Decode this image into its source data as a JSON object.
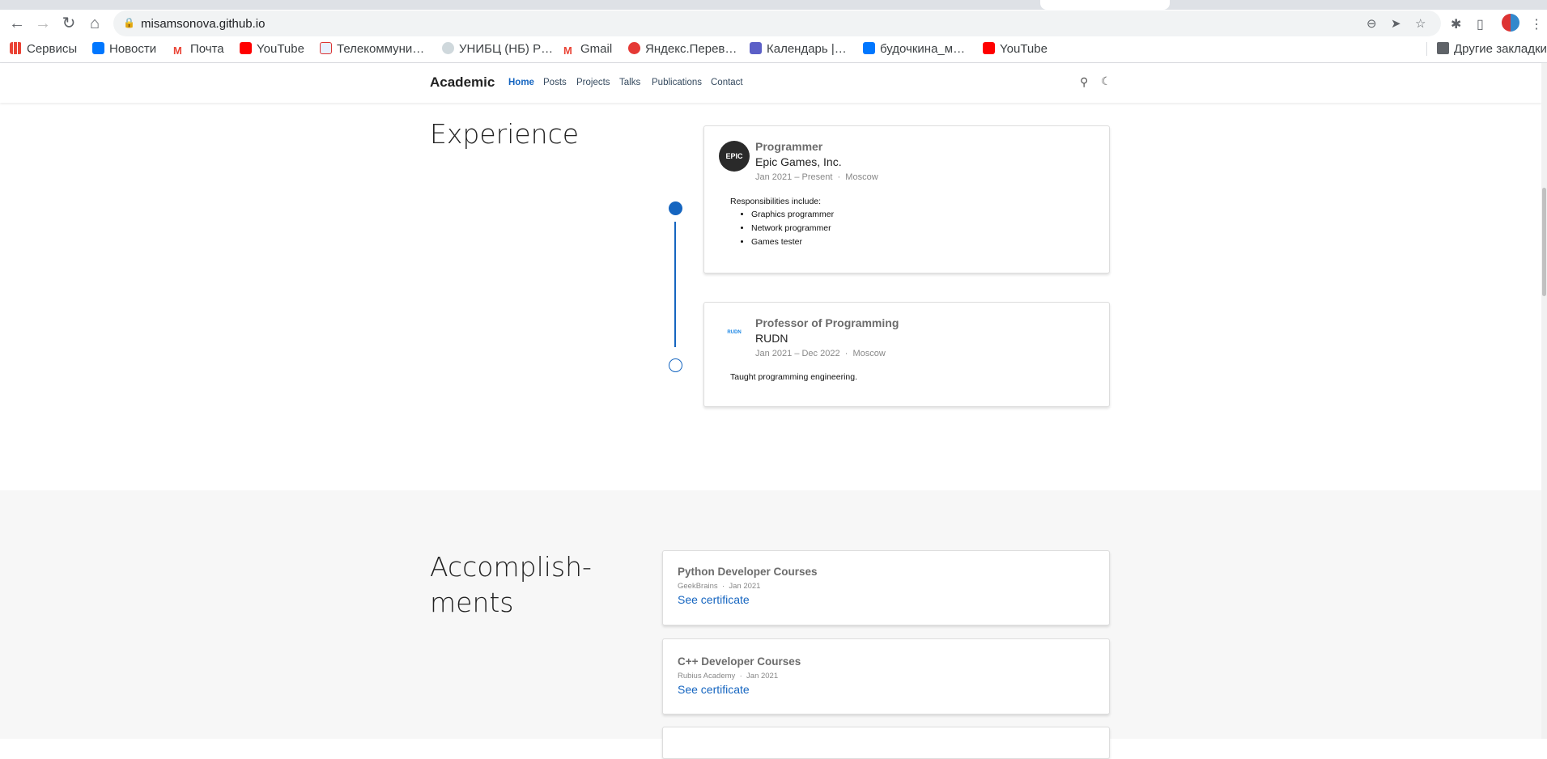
{
  "browser": {
    "url": "misamsonova.github.io",
    "bookmarks": [
      "Сервисы",
      "Новости",
      "Почта",
      "YouTube",
      "Телекоммуни…",
      "УНИБЦ (НБ) Р…",
      "Gmail",
      "Яндекс.Перев…",
      "Календарь |…",
      "будочкина_м…",
      "YouTube"
    ],
    "other_bookmarks": "Другие закладки"
  },
  "nav": {
    "brand": "Academic",
    "links": [
      "Home",
      "Posts",
      "Projects",
      "Talks",
      "Publications",
      "Contact"
    ],
    "active": "Home"
  },
  "experience": {
    "heading": "Experience",
    "items": [
      {
        "logo_text": "EPIC",
        "role": "Programmer",
        "org": "Epic Games, Inc.",
        "dates": "Jan 2021 – Present",
        "location": "Moscow",
        "intro": "Responsibilities include:",
        "bullets": [
          "Graphics programmer",
          "Network programmer",
          "Games tester"
        ]
      },
      {
        "logo_text": "RUDN",
        "role": "Professor of Programming",
        "org": "RUDN",
        "dates": "Jan 2021 – Dec 2022",
        "location": "Moscow",
        "intro": "Taught programming engineering."
      }
    ]
  },
  "accomplishments": {
    "heading_line1": "Accomplish-",
    "heading_line2": "ments",
    "items": [
      {
        "title": "Python Developer Courses",
        "org": "GeekBrains",
        "date": "Jan 2021",
        "link": "See certificate"
      },
      {
        "title": "C++ Developer Courses",
        "org": "Rubius Academy",
        "date": "Jan 2021",
        "link": "See certificate"
      }
    ]
  },
  "colors": {
    "accent": "#1565c0",
    "section_bg": "#f7f7f7"
  }
}
